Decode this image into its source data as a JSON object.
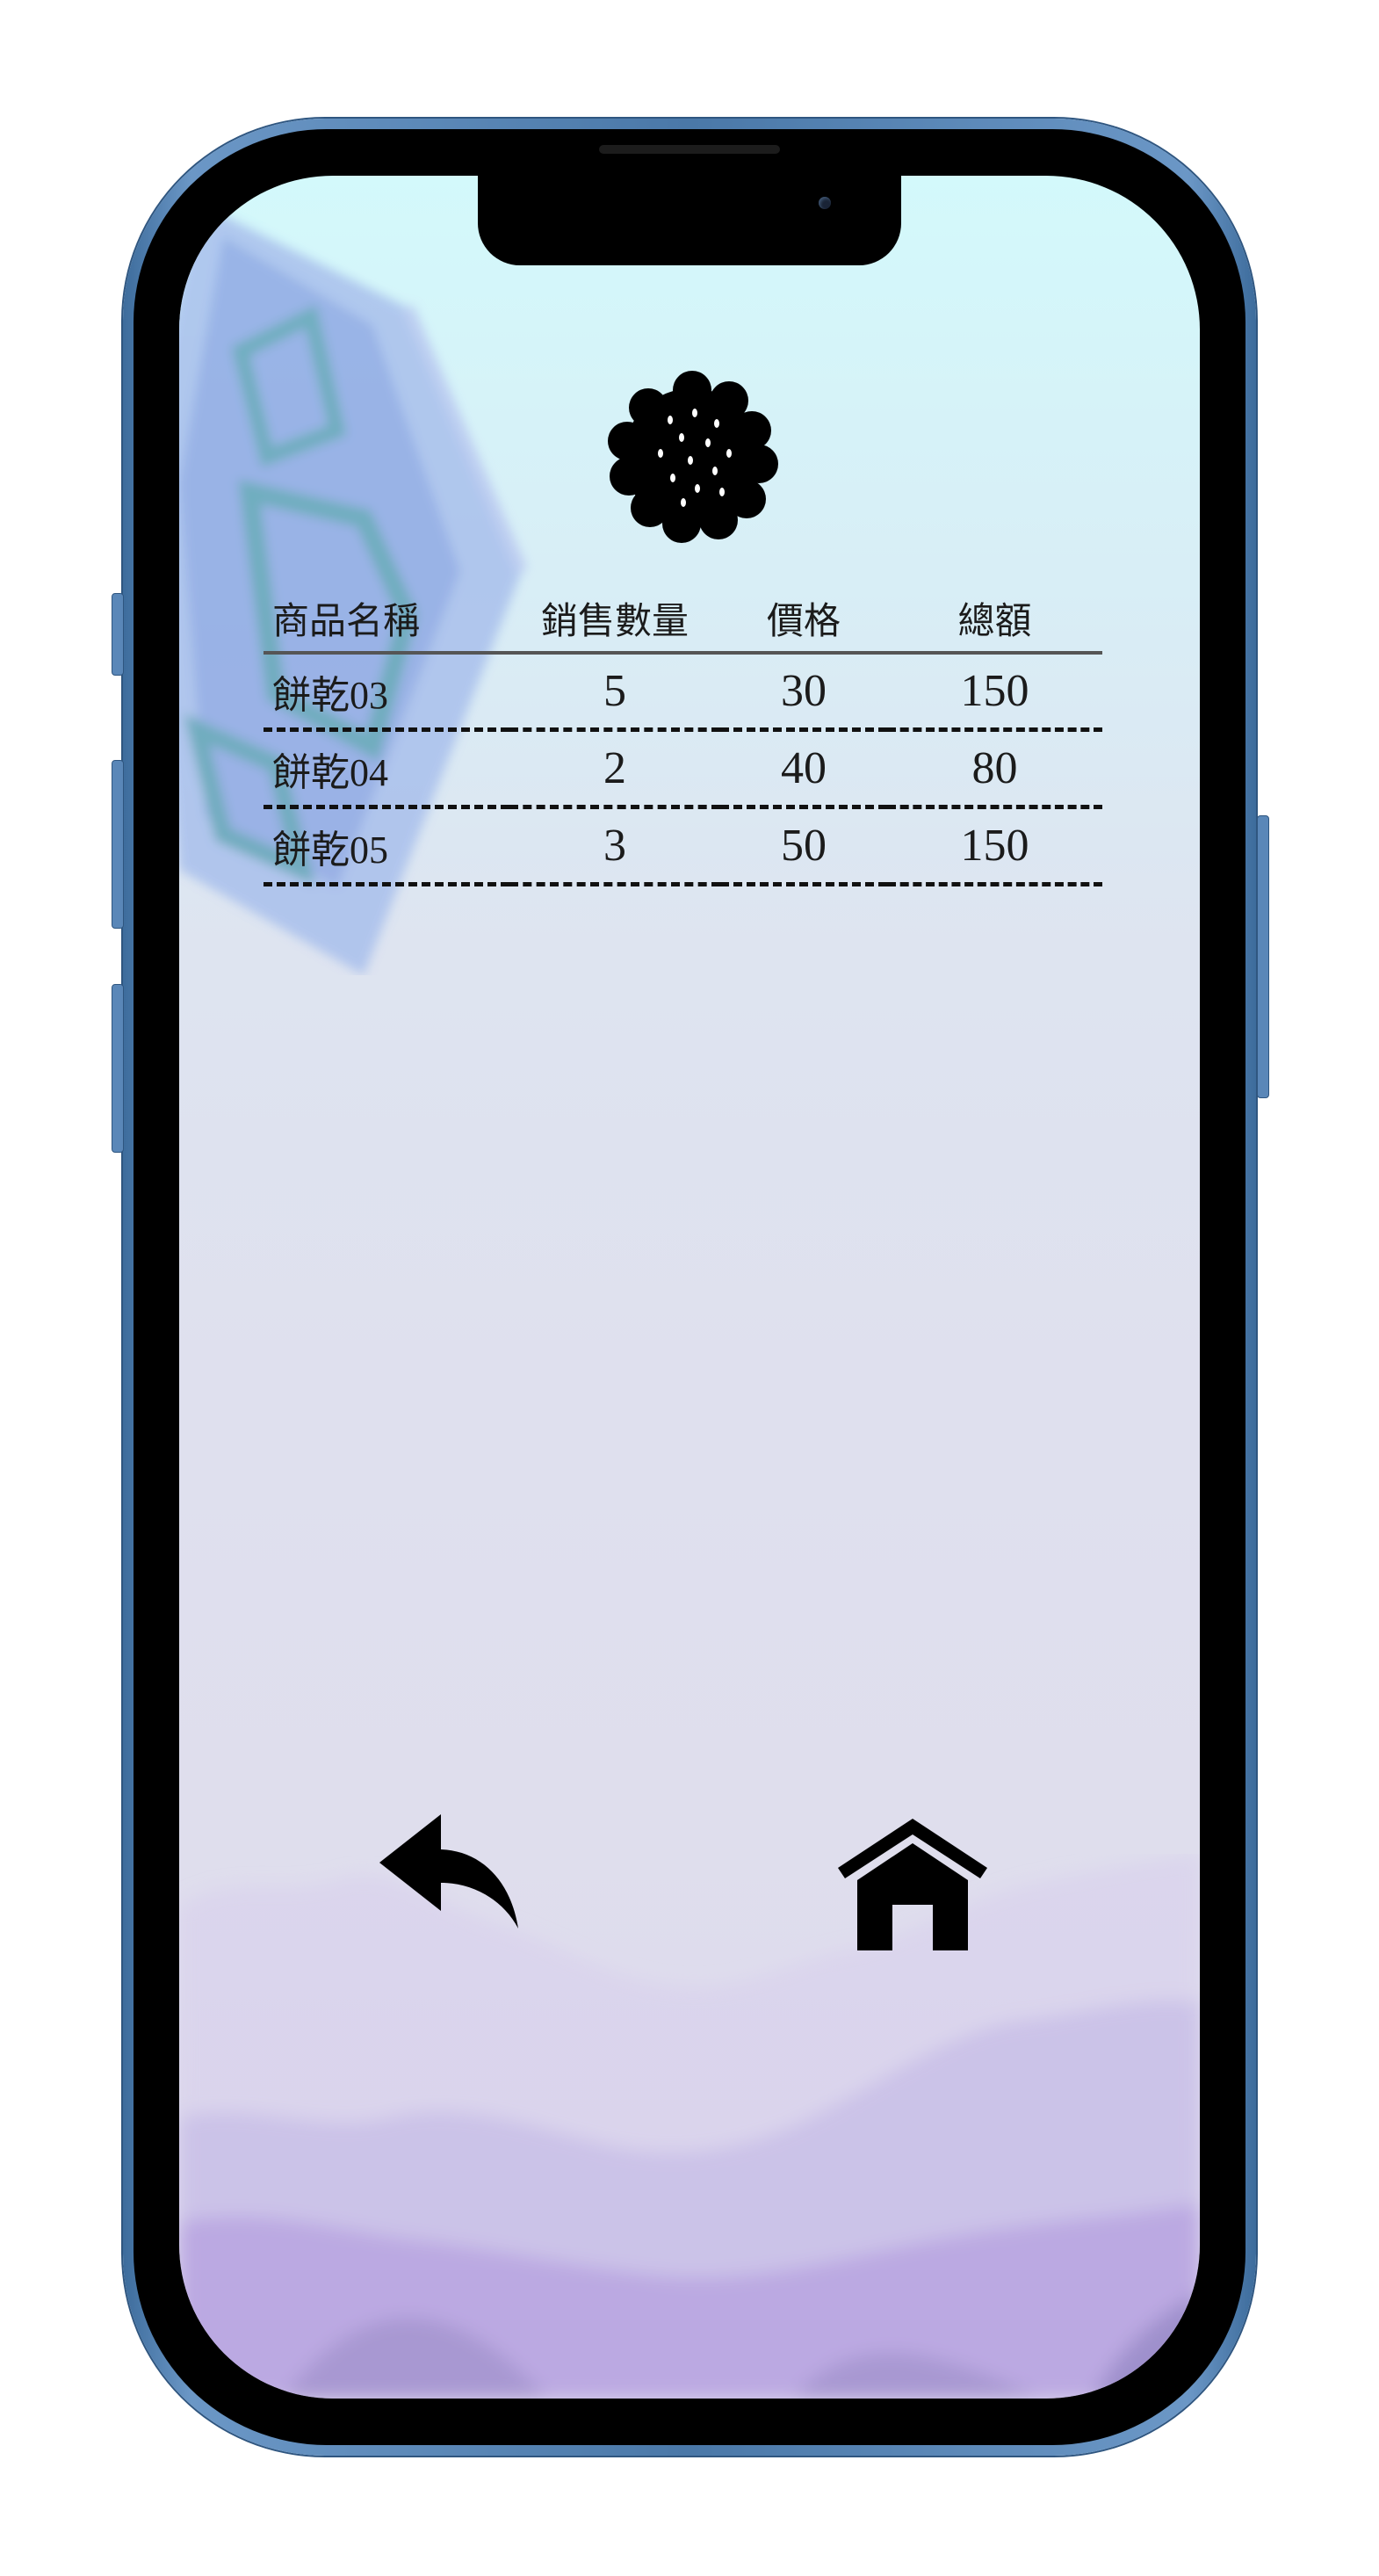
{
  "table": {
    "headers": [
      "商品名稱",
      "銷售數量",
      "價格",
      "總額"
    ],
    "rows": [
      [
        "餅乾03",
        "5",
        "30",
        "150"
      ],
      [
        "餅乾04",
        "2",
        "40",
        "80"
      ],
      [
        "餅乾05",
        "3",
        "50",
        "150"
      ]
    ]
  },
  "icons": {
    "top": "cookie-icon",
    "back": "back-arrow-icon",
    "home": "home-icon"
  },
  "colors": {
    "screen_top": "#d3f9fb",
    "screen_bottom": "#dcd6ec",
    "frame": "#4a78a8",
    "text": "#1b1b1b"
  }
}
